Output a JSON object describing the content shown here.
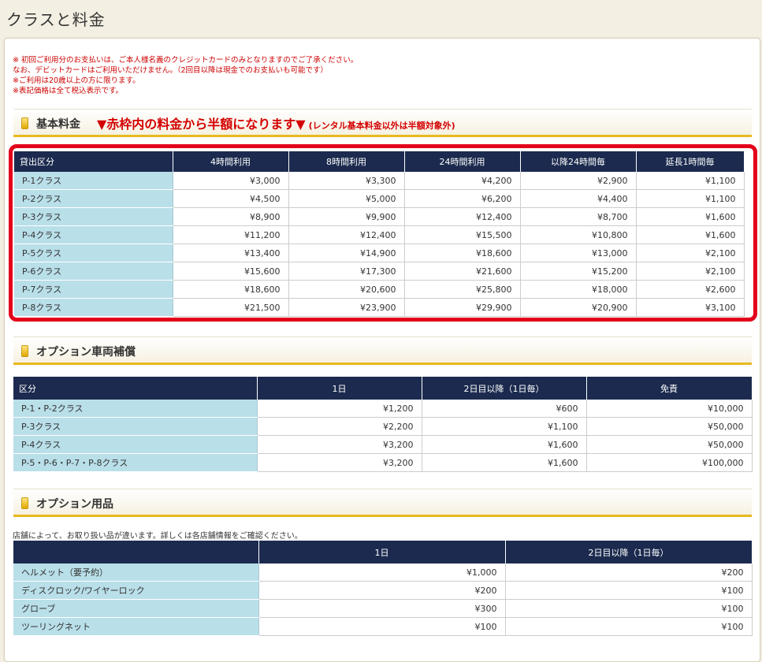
{
  "page": {
    "title": "クラスと料金"
  },
  "notes": [
    "※ 初回ご利用分のお支払いは、ご本人様名義のクレジットカードのみとなりますのでご了承ください。",
    "なお、デビットカードはご利用いただけません。（2回目以降は現金でのお支払いも可能です）",
    "※ご利用は20歳以上の方に限ります。",
    "※表記価格は全て税込表示です。"
  ],
  "basic": {
    "title": "基本料金",
    "promo": "▼赤枠内の料金から半額になります▼",
    "promo_sub": "(レンタル基本料金以外は半額対象外)",
    "headers": [
      "貸出区分",
      "4時間利用",
      "8時間利用",
      "24時間利用",
      "以降24時間毎",
      "延長1時間毎"
    ],
    "rows": [
      [
        "P-1クラス",
        "¥3,000",
        "¥3,300",
        "¥4,200",
        "¥2,900",
        "¥1,100"
      ],
      [
        "P-2クラス",
        "¥4,500",
        "¥5,000",
        "¥6,200",
        "¥4,400",
        "¥1,100"
      ],
      [
        "P-3クラス",
        "¥8,900",
        "¥9,900",
        "¥12,400",
        "¥8,700",
        "¥1,600"
      ],
      [
        "P-4クラス",
        "¥11,200",
        "¥12,400",
        "¥15,500",
        "¥10,800",
        "¥1,600"
      ],
      [
        "P-5クラス",
        "¥13,400",
        "¥14,900",
        "¥18,600",
        "¥13,000",
        "¥2,100"
      ],
      [
        "P-6クラス",
        "¥15,600",
        "¥17,300",
        "¥21,600",
        "¥15,200",
        "¥2,100"
      ],
      [
        "P-7クラス",
        "¥18,600",
        "¥20,600",
        "¥25,800",
        "¥18,000",
        "¥2,600"
      ],
      [
        "P-8クラス",
        "¥21,500",
        "¥23,900",
        "¥29,900",
        "¥20,900",
        "¥3,100"
      ]
    ]
  },
  "option_vehicle": {
    "title": "オプション車両補償",
    "headers": [
      "区分",
      "1日",
      "2日目以降（1日毎）",
      "免責"
    ],
    "rows": [
      [
        "P-1・P-2クラス",
        "¥1,200",
        "¥600",
        "¥10,000"
      ],
      [
        "P-3クラス",
        "¥2,200",
        "¥1,100",
        "¥50,000"
      ],
      [
        "P-4クラス",
        "¥3,200",
        "¥1,600",
        "¥50,000"
      ],
      [
        "P-5・P-6・P-7・P-8クラス",
        "¥3,200",
        "¥1,600",
        "¥100,000"
      ]
    ]
  },
  "option_goods": {
    "title": "オプション用品",
    "note": "店舗によって、お取り扱い品が違います。詳しくは各店舗情報をご確認ください。",
    "headers": [
      "",
      "1日",
      "2日目以降（1日毎）"
    ],
    "rows": [
      [
        "ヘルメット（要予約）",
        "¥1,000",
        "¥200"
      ],
      [
        "ディスクロック/ワイヤーロック",
        "¥200",
        "¥100"
      ],
      [
        "グローブ",
        "¥300",
        "¥100"
      ],
      [
        "ツーリングネット",
        "¥100",
        "¥100"
      ]
    ]
  },
  "colors": {
    "header_bg": "#1b2a4e",
    "label_bg": "#b9dfe9",
    "accent_red": "#e3001b",
    "section_underline": "#e8b820"
  }
}
